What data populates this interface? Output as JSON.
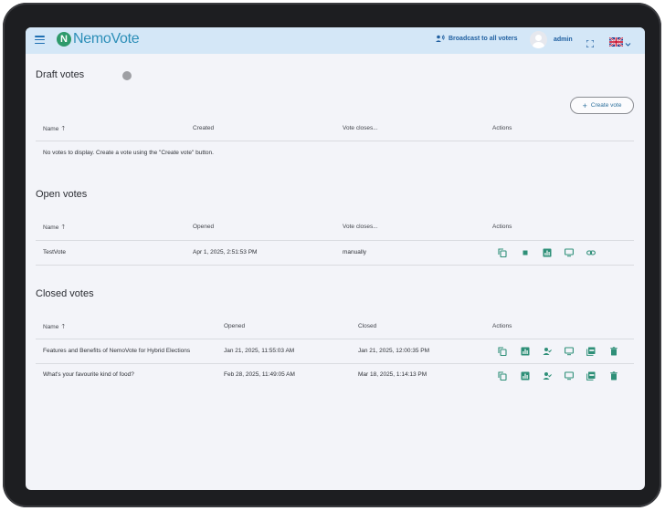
{
  "header": {
    "logo_letter": "N",
    "logo_text": "NemoVote",
    "broadcast_label": "Broadcast to all voters",
    "user_name": "admin"
  },
  "draft": {
    "title": "Draft votes",
    "create_label": "Create vote",
    "columns": [
      "Name",
      "Created",
      "Vote closes...",
      "Actions"
    ],
    "empty_message": "No votes to display. Create a vote using the \"Create vote\" button."
  },
  "open": {
    "title": "Open votes",
    "columns": [
      "Name",
      "Opened",
      "Vote closes...",
      "Actions"
    ],
    "rows": [
      {
        "name": "TestVote",
        "opened": "Apr 1, 2025, 2:51:53 PM",
        "closes": "manually"
      }
    ]
  },
  "closed": {
    "title": "Closed votes",
    "columns": [
      "Name",
      "Opened",
      "Closed",
      "Actions"
    ],
    "rows": [
      {
        "name": "Features and Benefits of NemoVote for Hybrid Elections",
        "opened": "Jan 21, 2025, 11:55:03 AM",
        "closed": "Jan 21, 2025, 12:00:35 PM"
      },
      {
        "name": "What's your favourite kind of food?",
        "opened": "Feb 28, 2025, 11:49:05 AM",
        "closed": "Mar 18, 2025, 1:14:13 PM"
      }
    ]
  },
  "colors": {
    "accent": "#2e8f78",
    "header_bg": "#d4e7f7",
    "link_blue": "#1f5fa0"
  }
}
